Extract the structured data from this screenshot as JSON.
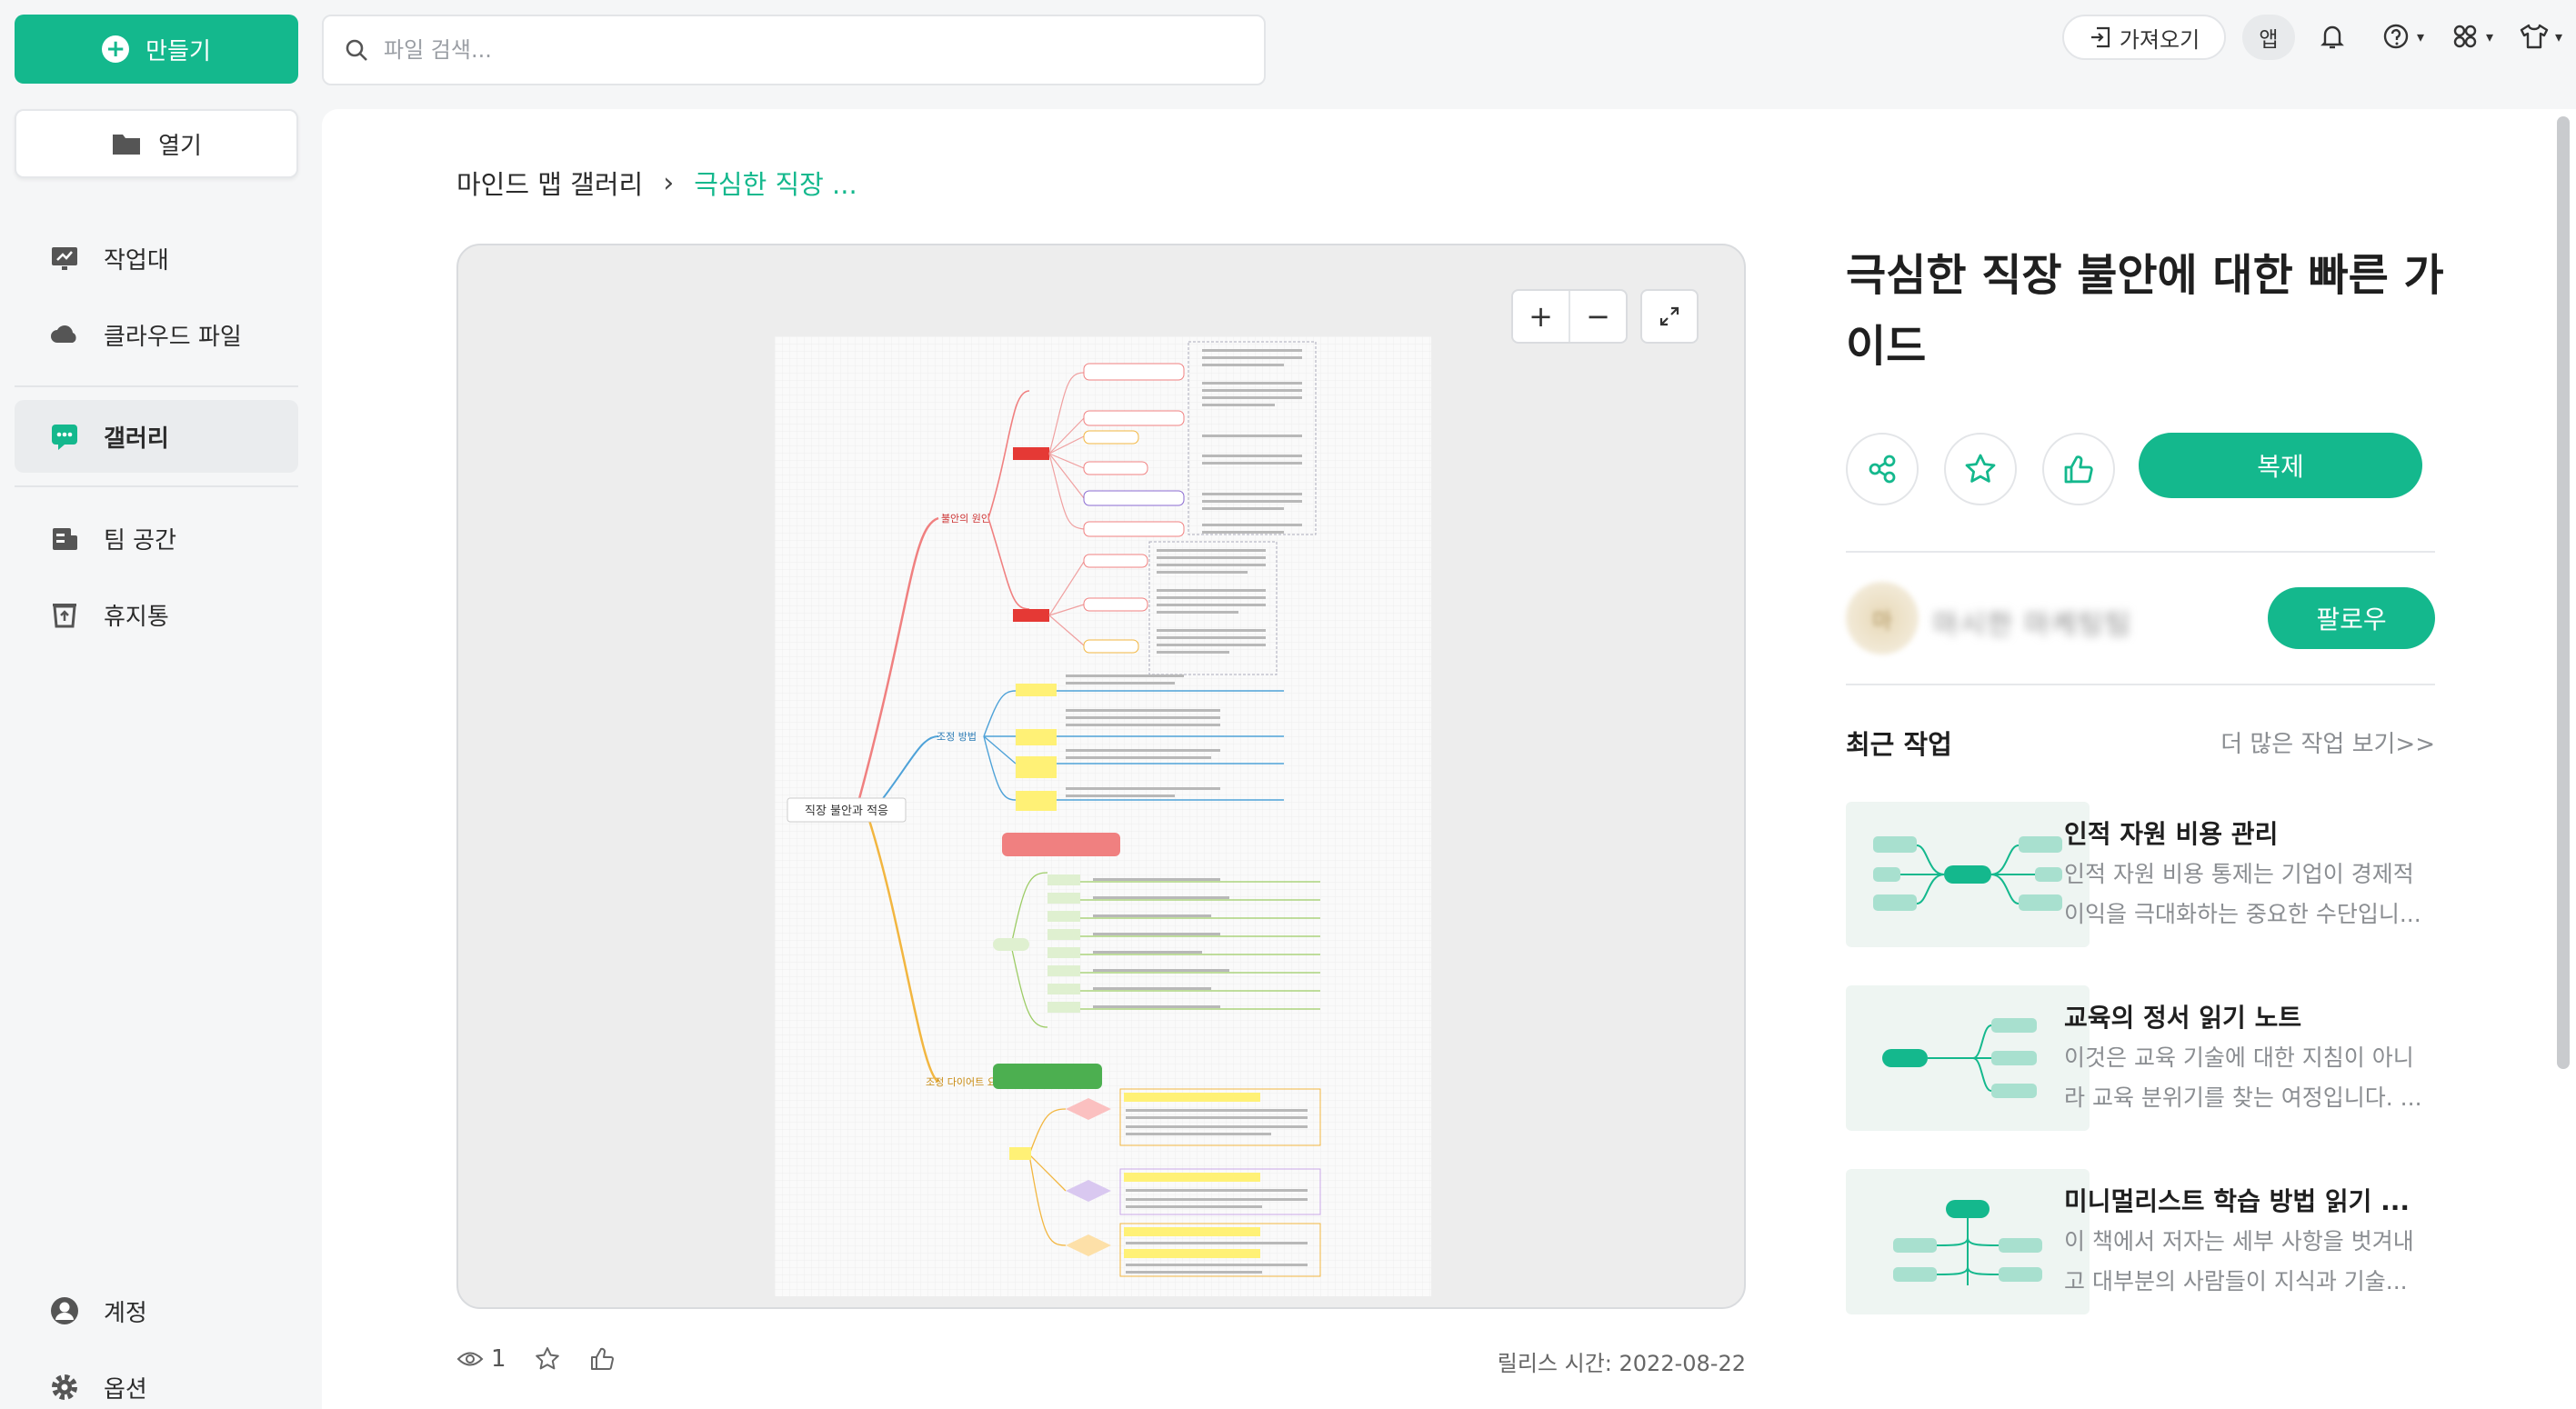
{
  "sidebar": {
    "create_label": "만들기",
    "open_label": "열기",
    "items": [
      {
        "label": "작업대",
        "icon": "workbench-icon"
      },
      {
        "label": "클라우드 파일",
        "icon": "cloud-icon"
      },
      {
        "label": "갤러리",
        "icon": "gallery-icon",
        "active": true
      },
      {
        "label": "팀 공간",
        "icon": "team-icon"
      },
      {
        "label": "휴지통",
        "icon": "trash-icon"
      }
    ],
    "bottom": [
      {
        "label": "계정",
        "icon": "account-icon"
      },
      {
        "label": "옵션",
        "icon": "settings-icon"
      }
    ]
  },
  "topbar": {
    "search_placeholder": "파일 검색...",
    "import_label": "가져오기",
    "app_label": "앱"
  },
  "breadcrumb": {
    "root": "마인드 맵 갤러리",
    "current": "극심한 직장 ..."
  },
  "preview": {
    "zoom_in": "+",
    "zoom_out": "−"
  },
  "stats": {
    "views": "1",
    "release_label": "릴리스 시간:",
    "release_date": "2022-08-22"
  },
  "detail": {
    "title": "극심한 직장 불안에 대한 빠른 가이드",
    "copy_label": "복제",
    "follow_label": "팔로우",
    "author_avatar_text": "마",
    "author_name": "마시한 마케팅팀"
  },
  "recent": {
    "title": "최근 작업",
    "more": "더 많은 작업 보기>>",
    "cards": [
      {
        "title": "인적 자원 비용 관리",
        "desc1": "인적 자원 비용 통제는 기업이 경제적",
        "desc2": "이익을 극대화하는 중요한 수단입니..."
      },
      {
        "title": "교육의 정서 읽기 노트",
        "desc1": "이것은 교육 기술에 대한 지침이 아니",
        "desc2": "라 교육 분위기를 찾는 여정입니다. ..."
      },
      {
        "title": "미니멀리스트 학습 방법 읽기 ...",
        "desc1": "이 책에서 저자는 세부 사항을 벗겨내",
        "desc2": "고 대부분의 사람들이 지식과 기술..."
      }
    ]
  },
  "mindmap": {
    "root": "직장 불안과 적응",
    "branches": [
      "불안의 원인",
      "조정 방법",
      "조정 다이어트 요법"
    ]
  },
  "colors": {
    "accent": "#14b88d"
  }
}
